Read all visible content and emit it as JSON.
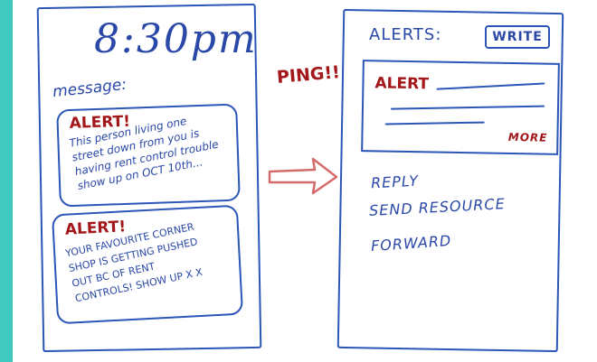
{
  "left_phone": {
    "time": "8:30pm",
    "section_label": "message:",
    "alerts": [
      {
        "title": "ALERT!",
        "lines": [
          "This person living one",
          "street down from you is",
          "having rent control trouble",
          "show up on OCT 10th..."
        ]
      },
      {
        "title": "ALERT!",
        "lines": [
          "YOUR FAVOURITE CORNER",
          "SHOP IS GETTING PUSHED",
          "OUT BC OF RENT",
          "CONTROLS! SHOW UP X X"
        ]
      }
    ]
  },
  "transition_label": "PING!!",
  "right_phone": {
    "header_title": "ALERTS:",
    "write_button": "WRITE",
    "alert_preview": {
      "title": "ALERT",
      "more_label": "MORE"
    },
    "actions": {
      "reply": "REPLY",
      "send_resource": "SEND RESOURCE",
      "forward": "FORWARD"
    }
  },
  "colors": {
    "background": "#3fc9bf",
    "ink_blue": "#2a48a8",
    "ink_red": "#a3161a",
    "arrow": "#d46b6b"
  }
}
